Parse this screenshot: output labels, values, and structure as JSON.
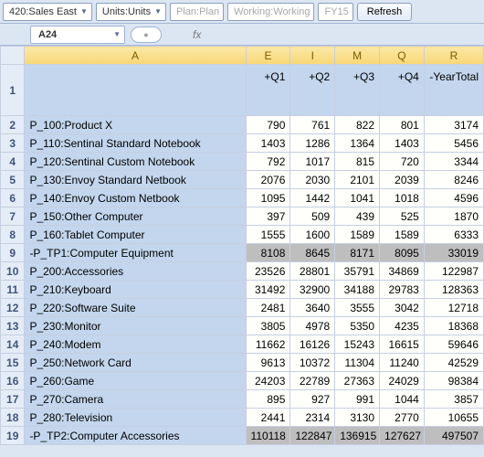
{
  "toolbar": {
    "dd1": "420:Sales East",
    "dd2": "Units:Units",
    "dd3": "Plan:Plan",
    "dd4": "Working:Working",
    "dd5": "FY15",
    "refresh_label": "Refresh"
  },
  "namebar": {
    "cell_ref": "A24",
    "fx_label": "fx"
  },
  "columns": {
    "A": "A",
    "E": "E",
    "I": "I",
    "M": "M",
    "Q": "Q",
    "R": "R"
  },
  "headers": {
    "q1": "+Q1",
    "q2": "+Q2",
    "q3": "+Q3",
    "q4": "+Q4",
    "yt": "-YearTotal"
  },
  "rows": [
    {
      "n": "2",
      "label": "P_100:Product X",
      "v": [
        "790",
        "761",
        "822",
        "801",
        "3174"
      ]
    },
    {
      "n": "3",
      "label": "P_110:Sentinal Standard Notebook",
      "v": [
        "1403",
        "1286",
        "1364",
        "1403",
        "5456"
      ]
    },
    {
      "n": "4",
      "label": "P_120:Sentinal Custom Notebook",
      "v": [
        "792",
        "1017",
        "815",
        "720",
        "3344"
      ]
    },
    {
      "n": "5",
      "label": "P_130:Envoy Standard Netbook",
      "v": [
        "2076",
        "2030",
        "2101",
        "2039",
        "8246"
      ]
    },
    {
      "n": "6",
      "label": "P_140:Envoy Custom Netbook",
      "v": [
        "1095",
        "1442",
        "1041",
        "1018",
        "4596"
      ]
    },
    {
      "n": "7",
      "label": "P_150:Other Computer",
      "v": [
        "397",
        "509",
        "439",
        "525",
        "1870"
      ]
    },
    {
      "n": "8",
      "label": "P_160:Tablet Computer",
      "v": [
        "1555",
        "1600",
        "1589",
        "1589",
        "6333"
      ]
    },
    {
      "n": "9",
      "label": "-P_TP1:Computer Equipment",
      "v": [
        "8108",
        "8645",
        "8171",
        "8095",
        "33019"
      ],
      "total": true
    },
    {
      "n": "10",
      "label": "P_200:Accessories",
      "v": [
        "23526",
        "28801",
        "35791",
        "34869",
        "122987"
      ]
    },
    {
      "n": "11",
      "label": "P_210:Keyboard",
      "v": [
        "31492",
        "32900",
        "34188",
        "29783",
        "128363"
      ]
    },
    {
      "n": "12",
      "label": "P_220:Software Suite",
      "v": [
        "2481",
        "3640",
        "3555",
        "3042",
        "12718"
      ]
    },
    {
      "n": "13",
      "label": "P_230:Monitor",
      "v": [
        "3805",
        "4978",
        "5350",
        "4235",
        "18368"
      ]
    },
    {
      "n": "14",
      "label": "P_240:Modem",
      "v": [
        "11662",
        "16126",
        "15243",
        "16615",
        "59646"
      ]
    },
    {
      "n": "15",
      "label": "P_250:Network Card",
      "v": [
        "9613",
        "10372",
        "11304",
        "11240",
        "42529"
      ]
    },
    {
      "n": "16",
      "label": "P_260:Game",
      "v": [
        "24203",
        "22789",
        "27363",
        "24029",
        "98384"
      ]
    },
    {
      "n": "17",
      "label": "P_270:Camera",
      "v": [
        "895",
        "927",
        "991",
        "1044",
        "3857"
      ]
    },
    {
      "n": "18",
      "label": "P_280:Television",
      "v": [
        "2441",
        "2314",
        "3130",
        "2770",
        "10655"
      ]
    },
    {
      "n": "19",
      "label": "-P_TP2:Computer Accessories",
      "v": [
        "110118",
        "122847",
        "136915",
        "127627",
        "497507"
      ],
      "total": true
    }
  ]
}
